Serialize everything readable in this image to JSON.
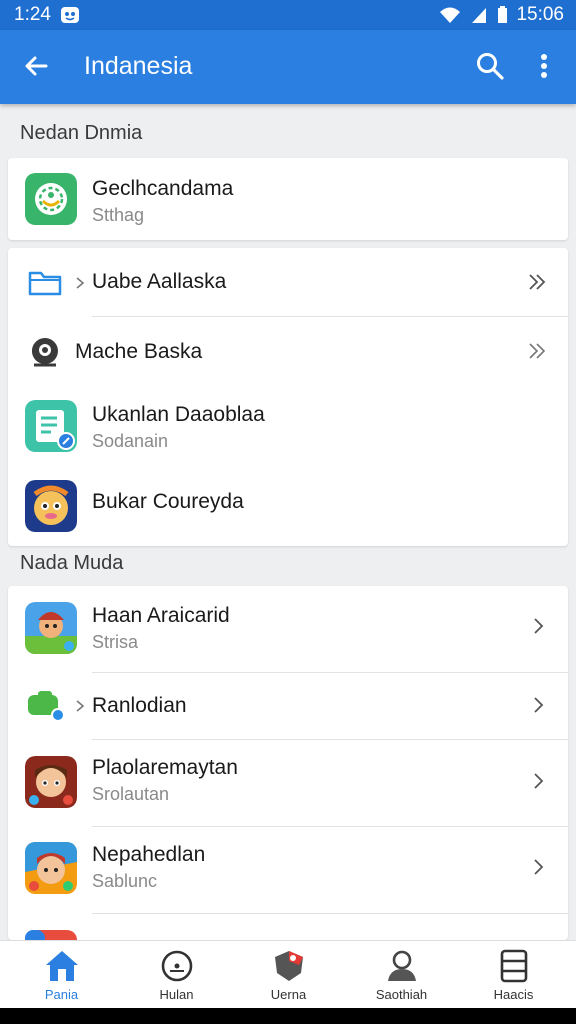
{
  "status_bar": {
    "time_left": "1:24",
    "time_right": "15:06"
  },
  "app_bar": {
    "title": "Indanesia"
  },
  "sections": [
    {
      "header": "Nedan Dnmia"
    },
    {
      "header": "Nada Muda"
    }
  ],
  "card1": {
    "item": {
      "title": "Geclhcandama",
      "subtitle": "Stthag"
    }
  },
  "card2": {
    "items": [
      {
        "title": "Uabe Aallaska"
      },
      {
        "title": "Mache Baska"
      },
      {
        "title": "Ukanlan Daaoblaa",
        "subtitle": "Sodanain"
      },
      {
        "title": "Bukar Coureyda"
      }
    ]
  },
  "card3": {
    "items": [
      {
        "title": "Haan Araicarid",
        "subtitle": "Strisa"
      },
      {
        "title": "Ranlodian"
      },
      {
        "title": "Plaolaremaytan",
        "subtitle": "Srolautan"
      },
      {
        "title": "Nepahedlan",
        "subtitle": "Sablunc"
      }
    ]
  },
  "bottom_nav": {
    "items": [
      {
        "label": "Pania",
        "icon": "home-icon"
      },
      {
        "label": "Hulan",
        "icon": "compass-icon"
      },
      {
        "label": "Uerna",
        "icon": "shield-icon"
      },
      {
        "label": "Saothiah",
        "icon": "person-icon"
      },
      {
        "label": "Haacis",
        "icon": "list-icon"
      }
    ]
  },
  "colors": {
    "status_bar": "#1f6fd0",
    "app_bar": "#2a7fe0",
    "accent": "#2a7fe0",
    "background": "#eeeff1"
  }
}
